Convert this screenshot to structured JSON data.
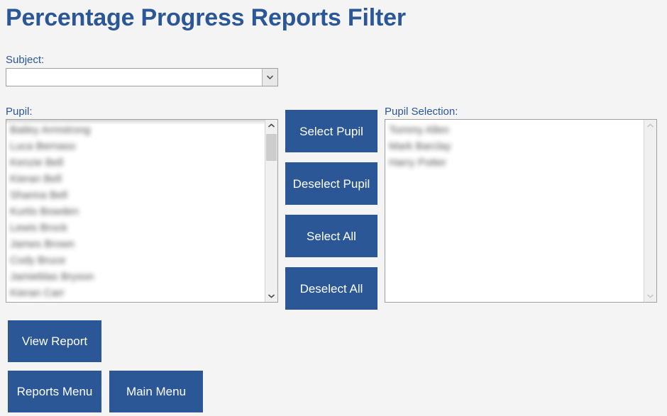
{
  "page": {
    "title": "Percentage Progress Reports Filter",
    "accent_color": "#2b5797",
    "background_color": "#f4f4f4"
  },
  "subject": {
    "label": "Subject:",
    "value": "",
    "placeholder": "",
    "dropdown_icon": "chevron-down-icon"
  },
  "pupil_list": {
    "label": "Pupil:",
    "items": [
      "Bailey Armstrong",
      "Luca Bernaso",
      "Kenzie Bell",
      "Kieran Bell",
      "Shanna Bell",
      "Kurtis Bowden",
      "Lewis Brock",
      "James Brown",
      "Cody Bruce",
      "Jamieblas Bryson",
      "Kieran Carr"
    ],
    "scrollbar": {
      "up_icon": "chevron-up-icon",
      "down_icon": "chevron-down-icon",
      "enabled": true
    }
  },
  "pupil_selection": {
    "label": "Pupil Selection:",
    "items": [
      "Tommy Allen",
      "Mark Barclay",
      "Harry Potter"
    ],
    "scrollbar": {
      "up_icon": "chevron-up-icon",
      "down_icon": "chevron-down-icon",
      "enabled": false
    }
  },
  "transfer_buttons": {
    "select_pupil": "Select Pupil",
    "deselect_pupil": "Deselect Pupil",
    "select_all": "Select All",
    "deselect_all": "Deselect All"
  },
  "action_buttons": {
    "view_report": "View Report",
    "reports_menu": "Reports Menu",
    "main_menu": "Main Menu"
  }
}
